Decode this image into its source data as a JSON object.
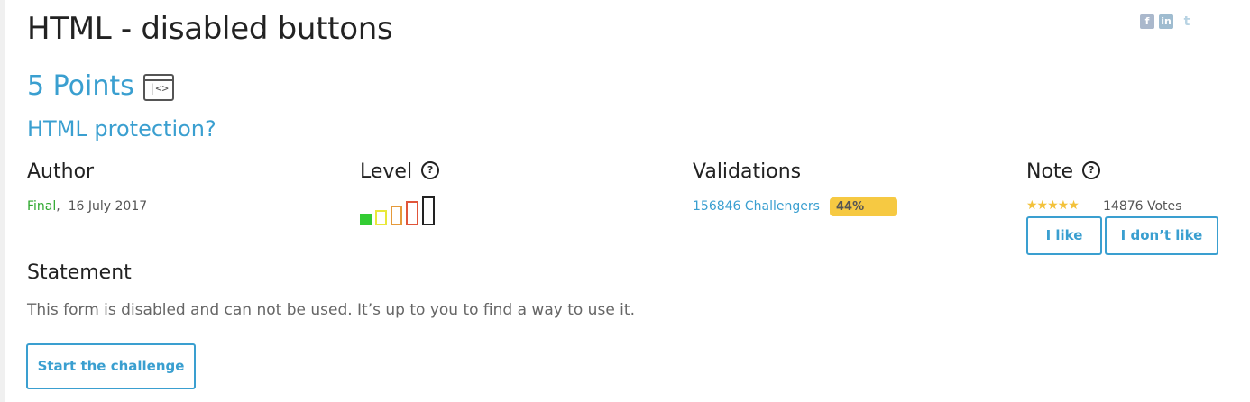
{
  "challenge": {
    "title": "HTML - disabled buttons",
    "points": "5 Points",
    "category_icon": "code-window-icon",
    "category_icon_text": "|<>",
    "subtitle": "HTML protection?"
  },
  "author": {
    "label": "Author",
    "status": "Final",
    "date": ",  16 July 2017"
  },
  "level": {
    "label": "Level",
    "help_icon": "?",
    "value": 1,
    "max": 5,
    "colors": [
      "#33cc33",
      "#e8e83a",
      "#e59a3a",
      "#e0553a",
      "#222222"
    ]
  },
  "validations": {
    "label": "Validations",
    "challengers": "156846 Challengers",
    "percent": "44%"
  },
  "note": {
    "label": "Note",
    "help_icon": "?",
    "stars": "★★★★★",
    "votes": "14876 Votes",
    "like_label": "I like",
    "dislike_label": "I don’t like"
  },
  "statement": {
    "heading": "Statement",
    "text": "This form is disabled and can not be used. It’s up to you to find a way to use it."
  },
  "actions": {
    "start_label": "Start the challenge"
  },
  "social": {
    "facebook": "f",
    "linkedin": "in",
    "twitter": "t"
  }
}
